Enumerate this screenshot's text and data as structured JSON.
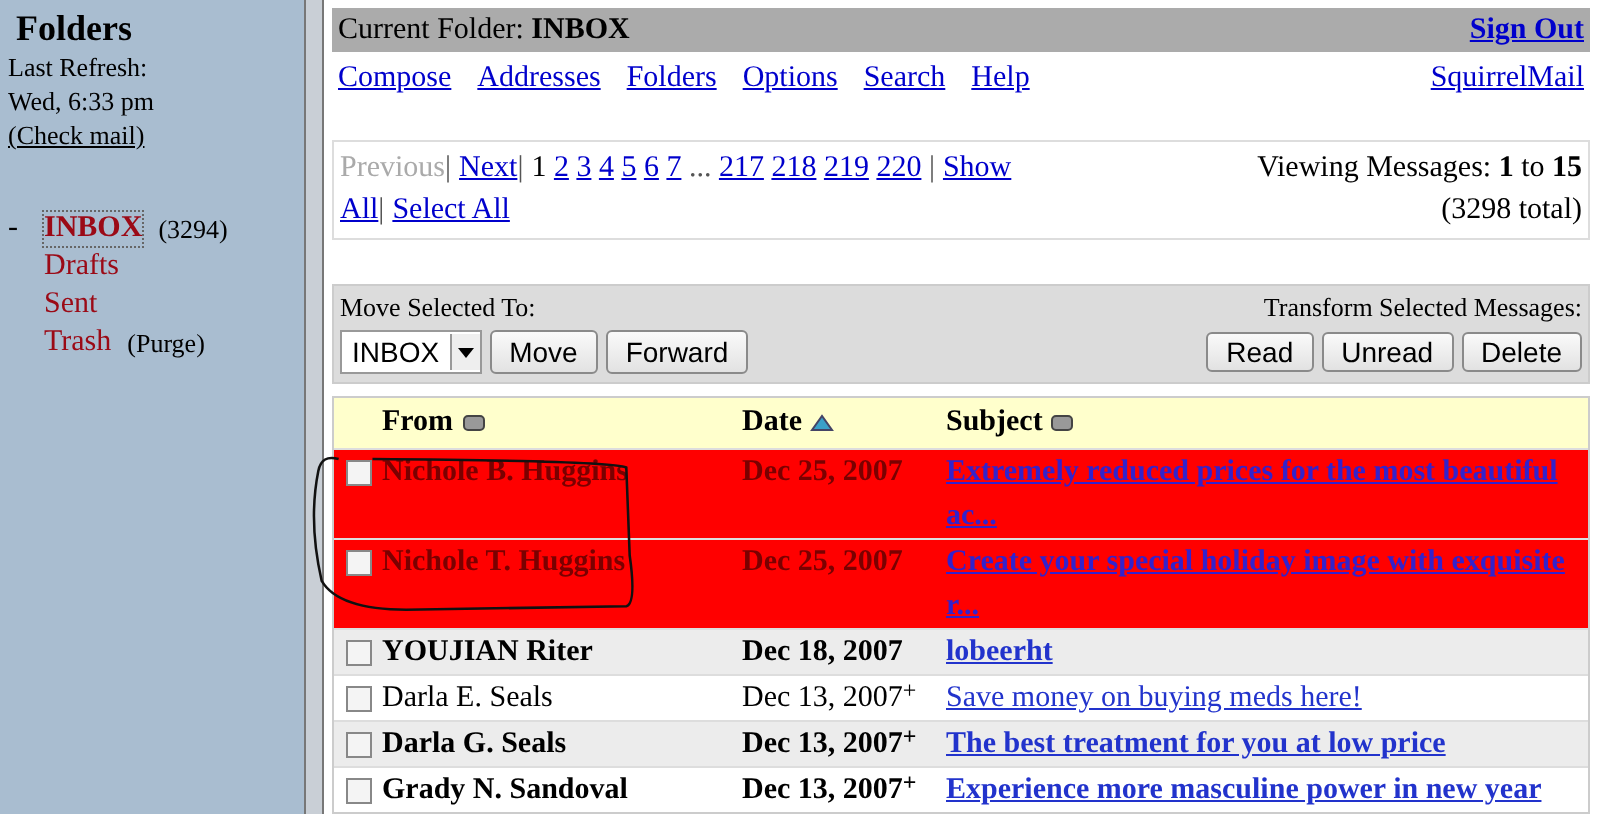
{
  "sidebar": {
    "title": "Folders",
    "last_refresh_label": "Last Refresh:",
    "last_refresh_time": "Wed, 6:33 pm",
    "check_mail": "(Check mail)",
    "collapse": "-",
    "folders": [
      {
        "name": "INBOX",
        "count": "(3294)",
        "selected": true
      },
      {
        "name": "Drafts",
        "selected": false
      },
      {
        "name": "Sent",
        "selected": false
      },
      {
        "name": "Trash",
        "action": "(Purge)",
        "selected": false
      }
    ]
  },
  "header": {
    "folder_label": "Current Folder:",
    "folder_name": "INBOX",
    "sign_out": "Sign Out"
  },
  "nav": {
    "links": [
      "Compose",
      "Addresses",
      "Folders",
      "Options",
      "Search",
      "Help"
    ],
    "brand": "SquirrelMail"
  },
  "pagination": {
    "lines": [
      [
        {
          "kind": "link",
          "label": "Previous",
          "disabled": true
        },
        {
          "kind": "separator",
          "label": "|"
        },
        {
          "kind": "link",
          "label": "Next",
          "disabled": false
        },
        {
          "kind": "separator",
          "label": "|"
        },
        {
          "kind": "page",
          "label": "1",
          "selected": true
        },
        {
          "kind": "page",
          "label": "2",
          "selected": false
        },
        {
          "kind": "page",
          "label": "3",
          "selected": false
        },
        {
          "kind": "page",
          "label": "4",
          "selected": false
        },
        {
          "kind": "page",
          "label": "5",
          "selected": false
        },
        {
          "kind": "page",
          "label": "6",
          "selected": false
        },
        {
          "kind": "page",
          "label": "7",
          "selected": false
        },
        {
          "kind": "gap",
          "label": "..."
        },
        {
          "kind": "page",
          "label": "217",
          "selected": false
        },
        {
          "kind": "page",
          "label": "218",
          "selected": false
        },
        {
          "kind": "page",
          "label": "219",
          "selected": false
        },
        {
          "kind": "page",
          "label": "220",
          "selected": false
        },
        {
          "kind": "separator",
          "label": "|"
        },
        {
          "kind": "link",
          "label": "Show",
          "disabled": false
        }
      ],
      [
        {
          "kind": "link",
          "label": "All",
          "disabled": false
        },
        {
          "kind": "separator",
          "label": "|"
        },
        {
          "kind": "link",
          "label": "Select All",
          "disabled": false
        }
      ]
    ],
    "viewing_prefix": "Viewing Messages:",
    "viewing_from": "1",
    "viewing_to_word": "to",
    "viewing_to": "15",
    "total": "(3298 total)"
  },
  "toolbar": {
    "move_label": "Move Selected To:",
    "folder_select": "INBOX",
    "move": "Move",
    "forward": "Forward",
    "transform_label": "Transform Selected Messages:",
    "buttons": [
      "Read",
      "Unread",
      "Delete"
    ]
  },
  "table": {
    "columns": [
      {
        "label": "From",
        "sorted": false
      },
      {
        "label": "Date",
        "sorted": true
      },
      {
        "label": "Subject",
        "sorted": false
      }
    ],
    "rows": [
      {
        "from": "Nichole B. Huggins",
        "date": "Dec 25, 2007",
        "subject": "Extremely reduced prices for the most beautiful ac...",
        "flagged": true,
        "unread": true,
        "checked": false
      },
      {
        "from": "Nichole T. Huggins",
        "date": "Dec 25, 2007",
        "subject": "Create your special holiday image with exquisite r...",
        "flagged": true,
        "unread": true,
        "checked": false
      },
      {
        "from": "YOUJIAN Riter",
        "date": "Dec 18, 2007",
        "subject": "lobeerht",
        "flagged": false,
        "unread": true,
        "checked": false
      },
      {
        "from": "Darla E. Seals",
        "date": "Dec 13, 2007",
        "subject": "Save money on buying meds here!",
        "flagged": false,
        "unread": false,
        "attachment": "+",
        "checked": false
      },
      {
        "from": "Darla G. Seals",
        "date": "Dec 13, 2007",
        "subject": "The best treatment for you at low price",
        "flagged": false,
        "unread": true,
        "attachment": "+",
        "checked": false
      },
      {
        "from": "Grady N. Sandoval",
        "date": "Dec 13, 2007",
        "subject": "Experience more masculine power in new year",
        "flagged": false,
        "unread": true,
        "attachment": "+",
        "checked": false
      }
    ]
  }
}
